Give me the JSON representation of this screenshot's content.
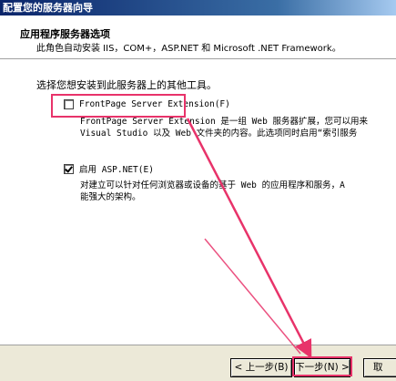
{
  "window": {
    "title": "配置您的服务器向导"
  },
  "header": {
    "title": "应用程序服务器选项",
    "subtitle": "此角色自动安装 IIS，COM+，ASP.NET 和 Microsoft .NET Framework。"
  },
  "main": {
    "prompt": "选择您想安装到此服务器上的其他工具。",
    "options": [
      {
        "label": "FrontPage Server Extension(F)",
        "checked": false,
        "description_lines": [
          "FrontPage Server Extension 是一组 Web 服务器扩展，您可以用来",
          "Visual Studio 以及 Web 文件夹的内容。此选项同时启用“索引服务"
        ]
      },
      {
        "label": "启用 ASP.NET(E)",
        "checked": true,
        "description_lines": [
          "对建立可以针对任何浏览器或设备的基于 Web 的应用程序和服务，A",
          "能强大的架构。"
        ]
      }
    ]
  },
  "footer": {
    "back_label": "< 上一步(B)",
    "next_label": "下一步(N) >",
    "cancel_label": "取"
  },
  "colors": {
    "annotation": "#e8336a",
    "titlebar": "#0a246a",
    "face": "#ece9d8"
  }
}
